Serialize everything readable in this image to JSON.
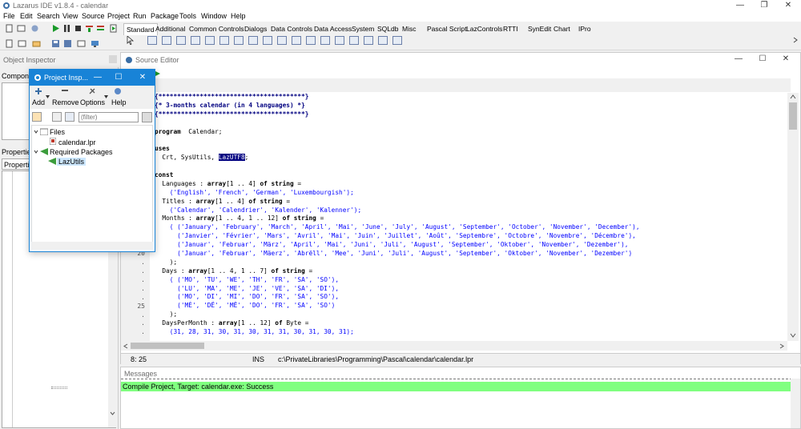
{
  "window": {
    "title": "Lazarus IDE v1.8.4 - calendar"
  },
  "menu": [
    "File",
    "Edit",
    "Search",
    "View",
    "Source",
    "Project",
    "Run",
    "Package",
    "Tools",
    "Window",
    "Help"
  ],
  "palette_tabs": [
    "Standard",
    "Additional",
    "Common Controls",
    "Dialogs",
    "Data Controls",
    "Data Access",
    "System",
    "SQLdb",
    "Misc",
    "Pascal Script",
    "LazControls",
    "RTTI",
    "SynEdit",
    "Chart",
    "IPro"
  ],
  "object_inspector": {
    "title": "Object Inspector",
    "component_label": "Compone",
    "properties_label": "Properties",
    "tab_label": "Propertie"
  },
  "project_inspector": {
    "title": "Project Insp...",
    "buttons": {
      "add": "Add",
      "remove": "Remove",
      "options": "Options",
      "help": "Help"
    },
    "filter_placeholder": "(filter)",
    "tree": {
      "files": "Files",
      "file1": "calendar.lpr",
      "required": "Required Packages",
      "pkg1": "LazUtils"
    }
  },
  "source_editor": {
    "title": "Source Editor",
    "code_lines": [
      {
        "t": "cm",
        "v": "{***************************************}"
      },
      {
        "t": "cm",
        "v": "{* 3-months calendar (in 4 languages) *}"
      },
      {
        "t": "cm",
        "v": "{***************************************}"
      },
      {
        "t": "",
        "v": ""
      },
      {
        "t": "mix",
        "parts": [
          [
            "kw",
            "program"
          ],
          [
            "",
            "  Calendar;"
          ]
        ]
      },
      {
        "t": "",
        "v": ""
      },
      {
        "t": "kw",
        "v": "uses"
      },
      {
        "t": "mix",
        "parts": [
          [
            "",
            "  Crt, SysUtils, "
          ],
          [
            "sel",
            "LazUTF8"
          ],
          [
            "",
            ";"
          ]
        ]
      },
      {
        "t": "",
        "v": ""
      },
      {
        "t": "kw",
        "v": "const"
      },
      {
        "t": "mix",
        "parts": [
          [
            "",
            "  Languages : "
          ],
          [
            "kw",
            "array"
          ],
          [
            "",
            "[1 .. 4] "
          ],
          [
            "kw",
            "of string"
          ],
          [
            "",
            " ="
          ]
        ]
      },
      {
        "t": "st",
        "v": "    ('English', 'French', 'German', 'Luxembourgish');"
      },
      {
        "t": "mix",
        "parts": [
          [
            "",
            "  Titles : "
          ],
          [
            "kw",
            "array"
          ],
          [
            "",
            "[1 .. 4] "
          ],
          [
            "kw",
            "of string"
          ],
          [
            "",
            " ="
          ]
        ]
      },
      {
        "t": "st",
        "v": "    ('Calendar', 'Calendrier', 'Kalender', 'Kalenner');"
      },
      {
        "t": "mix",
        "parts": [
          [
            "",
            "  Months : "
          ],
          [
            "kw",
            "array"
          ],
          [
            "",
            "[1 .. 4, 1 .. 12] "
          ],
          [
            "kw",
            "of string"
          ],
          [
            "",
            " ="
          ]
        ]
      },
      {
        "t": "st",
        "v": "    ( ('January', 'February', 'March', 'April', 'Mai', 'June', 'July', 'August', 'September', 'October', 'November', 'December'),"
      },
      {
        "t": "st",
        "v": "      ('Janvier', 'Février', 'Mars', 'Avril', 'Mai', 'Juin', 'Juillet', 'Août', 'Septembre', 'Octobre', 'Novembre', 'Décembre'),"
      },
      {
        "t": "st",
        "v": "      ('Januar', 'Februar', 'März', 'April', 'Mai', 'Juni', 'Juli', 'August', 'September', 'Oktober', 'November', 'Dezember'),"
      },
      {
        "t": "st",
        "v": "      ('Januar', 'Februar', 'Mäerz', 'Abrëll', 'Mee', 'Juni', 'Juli', 'August', 'September', 'Oktober', 'November', 'Dezember')"
      },
      {
        "t": "",
        "v": "    );"
      },
      {
        "t": "mix",
        "parts": [
          [
            "",
            "  Days : "
          ],
          [
            "kw",
            "array"
          ],
          [
            "",
            "[1 .. 4, 1 .. 7] "
          ],
          [
            "kw",
            "of string"
          ],
          [
            "",
            " ="
          ]
        ]
      },
      {
        "t": "st",
        "v": "    ( ('MO', 'TU', 'WE', 'TH', 'FR', 'SA', 'SO'),"
      },
      {
        "t": "st",
        "v": "      ('LU', 'MA', 'ME', 'JE', 'VE', 'SA', 'DI'),"
      },
      {
        "t": "st",
        "v": "      ('MO', 'DI', 'MI', 'DO', 'FR', 'SA', 'SO'),"
      },
      {
        "t": "st",
        "v": "      ('MÉ', 'DË', 'MË', 'DO', 'FR', 'SA', 'SO')"
      },
      {
        "t": "",
        "v": "    );"
      },
      {
        "t": "mix",
        "parts": [
          [
            "",
            "  DaysPerMonth : "
          ],
          [
            "kw",
            "array"
          ],
          [
            "",
            "[1 .. 12] "
          ],
          [
            "kw",
            "of"
          ],
          [
            "",
            " Byte ="
          ]
        ]
      },
      {
        "t": "st",
        "v": "    (31, 28, 31, 30, 31, 30, 31, 31, 30, 31, 30, 31);"
      }
    ],
    "gutter": [
      ".",
      ".",
      ".",
      ".",
      ".",
      ".",
      ".",
      ".",
      ".",
      ".",
      ".",
      ".",
      ".",
      ".",
      ".",
      ".",
      ".",
      ".",
      "20",
      ".",
      ".",
      ".",
      ".",
      ".",
      "25",
      ".",
      ".",
      "."
    ],
    "status": {
      "pos": "8: 25",
      "mode": "INS",
      "path": "c:\\PrivateLibraries\\Programming\\Pascal\\calendar\\calendar.lpr"
    }
  },
  "messages": {
    "title": "Messages",
    "line": "Compile Project, Target: calendar.exe: Success"
  },
  "colors": {
    "accent": "#1883d7",
    "success": "#80ff80"
  }
}
